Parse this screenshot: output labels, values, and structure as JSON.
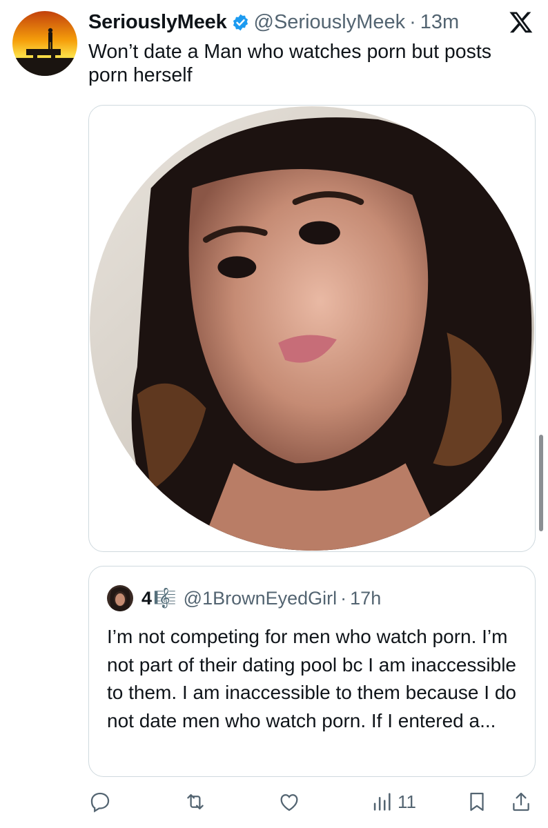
{
  "author": {
    "display_name": "SeriouslyMeek",
    "verified": true,
    "handle": "@SeriouslyMeek",
    "separator": "·",
    "time": "13m"
  },
  "tweet": {
    "text": "Won’t date a Man who watches porn but posts porn herself"
  },
  "quoted": {
    "display_name": "4",
    "name_glyph": "🎼",
    "handle": "@1BrownEyedGirl",
    "separator": "·",
    "time": "17h",
    "text": "I’m not competing for men who watch porn. I’m not part of their dating pool bc I am inaccessible to them. I am inaccessible to them because I do not date men who watch porn. If I entered a..."
  },
  "actions": {
    "views": "11"
  },
  "icons": {
    "brand": "x-logo-icon",
    "verified": "verified-badge-icon",
    "reply": "reply-icon",
    "retweet": "retweet-icon",
    "like": "like-icon",
    "views": "views-icon",
    "bookmark": "bookmark-icon",
    "share": "share-icon"
  },
  "colors": {
    "verified": "#1d9bf0",
    "secondary_text": "#536471",
    "border": "#cfd9de"
  }
}
